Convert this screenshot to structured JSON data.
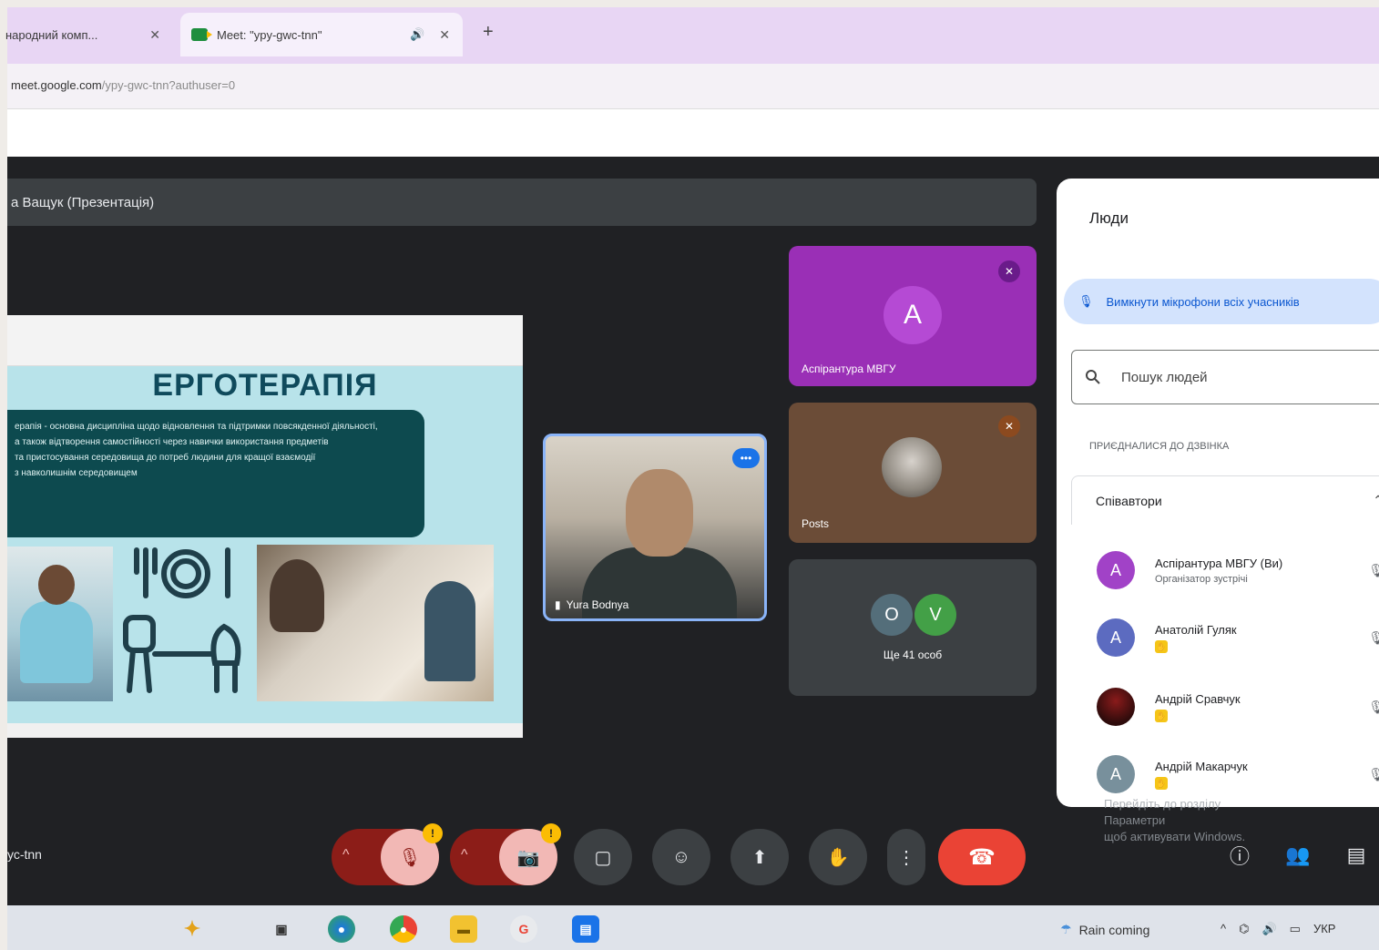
{
  "browser": {
    "tab_inactive_label": "народний комп...",
    "tab_active_label": "Meet: \"ypy-gwc-tnn\"",
    "new_tab": "+",
    "close_glyph": "✕",
    "url_host": "meet.google.com",
    "url_path": "/ypy-gwc-tnn?authuser=0"
  },
  "meet": {
    "presenter_label": "а Ващук (Презентація)",
    "meeting_code": "ус-tnn",
    "slide": {
      "title": "ЕРГОТЕРАПІЯ",
      "text_lines": [
        "ерапія - основна дисципліна щодо відновлення та підтримки повсякденної діяльності,",
        "а також відтворення самостійності через навички використання предметів",
        "та пристосування середовища до потреб людини для кращої взаємодії",
        "з навколишнім середовищем"
      ]
    },
    "main_tile_name": "Yura Bodnya",
    "tile_dots": "•••",
    "tiles": {
      "a_letter": "A",
      "a_name": "Аспірантура МВГУ",
      "r_name": "Posts",
      "o_letter": "O",
      "v_letter": "V",
      "others_label": "Ще 41 особ"
    },
    "accent": "#8ab4f8"
  },
  "panel": {
    "title": "Люди",
    "mute_all": "Вимкнути мікрофони всіх учасників",
    "search_placeholder": "Пошук людей",
    "added": "ПРИЄДНАЛИСЯ ДО ДЗВІНКА",
    "group": "Співавтори",
    "people": [
      {
        "letter": "A",
        "name": "Аспірантура МВГУ (Ви)",
        "sub": "Організатор зустрічі",
        "color": "#a142c7"
      },
      {
        "letter": "A",
        "name": "Анатолій Гуляк",
        "sub": "",
        "color": "#5c6bc0"
      },
      {
        "letter": "",
        "name": "Андрій Сравчук",
        "sub": "",
        "color": "#5a1010"
      },
      {
        "letter": "A",
        "name": "Андрій Макарчук",
        "sub": "",
        "color": "#78909c"
      }
    ],
    "hint_line1": "Перейдіть до розділу",
    "hint_line2": "Параметри",
    "hint_line3": "щоб активувати Windows."
  },
  "controls": {
    "mic_badge": "!",
    "cam_badge": "!"
  },
  "taskbar": {
    "weather": "Rain coming",
    "lang": "УКР"
  }
}
